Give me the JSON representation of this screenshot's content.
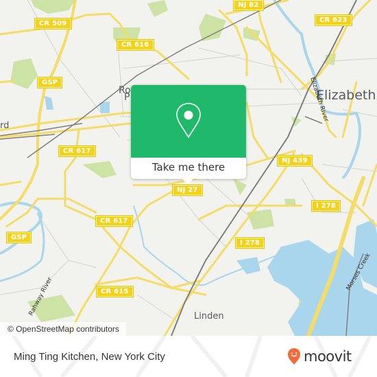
{
  "map": {
    "attribution": "© OpenStreetMap contributors",
    "colors": {
      "land": "#f2f2ee",
      "road_major": "#f5dc66",
      "road_minor": "#d4d2cc",
      "water": "#a9d6ec",
      "park": "#cde3a6",
      "rail": "#7f7f7f",
      "shield": "#f2d21b"
    },
    "road_shields": [
      {
        "label": "CR 509"
      },
      {
        "label": "CR 616"
      },
      {
        "label": "GSP"
      },
      {
        "label": "CR 617"
      },
      {
        "label": "NJ 82"
      },
      {
        "label": "CR 623"
      },
      {
        "label": "NJ 439"
      },
      {
        "label": "NJ 27"
      },
      {
        "label": "CR 617"
      },
      {
        "label": "GSP"
      },
      {
        "label": "I 278"
      },
      {
        "label": "I 278"
      },
      {
        "label": "CR 615"
      }
    ],
    "places": [
      {
        "label": "Elizabeth"
      },
      {
        "label": "Linden"
      },
      {
        "label": "Ro"
      },
      {
        "label": "P"
      },
      {
        "label": "rd"
      }
    ],
    "waterways": [
      {
        "label": "Elizabeth River"
      },
      {
        "label": "Rahway River"
      },
      {
        "label": "Morses Creek"
      }
    ]
  },
  "popup": {
    "icon": "location-pin-icon",
    "button_label": "Take me there",
    "color": "#20b86a"
  },
  "footer": {
    "title": "Ming Ting Kitchen, New York City",
    "brand": "moovit",
    "brand_color": "#f26b3a"
  }
}
